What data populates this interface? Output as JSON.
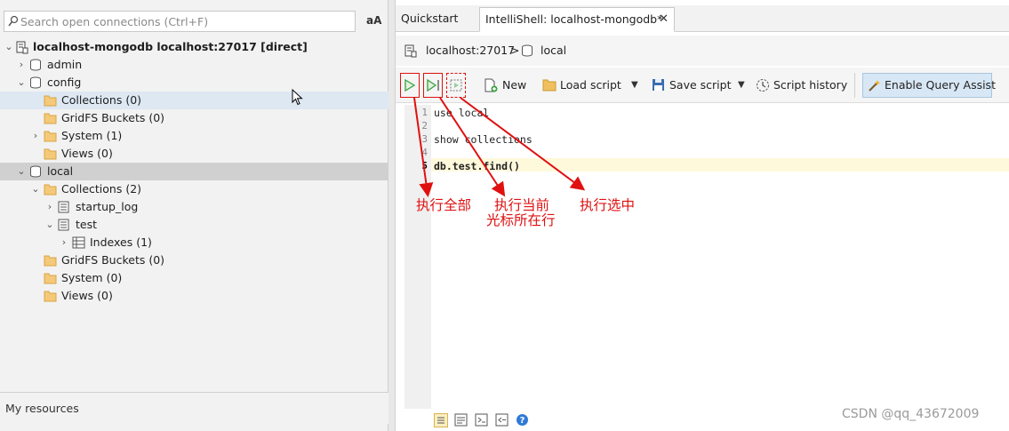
{
  "search": {
    "placeholder": "Search open connections (Ctrl+F)",
    "case_toggle": "aA"
  },
  "tree": {
    "connection": "localhost-mongodb localhost:27017 [direct]",
    "admin": "admin",
    "config": "config",
    "config_collections": "Collections (0)",
    "config_gridfs": "GridFS Buckets (0)",
    "config_system": "System (1)",
    "config_views": "Views (0)",
    "local": "local",
    "local_collections": "Collections (2)",
    "startup_log": "startup_log",
    "test": "test",
    "indexes": "Indexes (1)",
    "local_gridfs": "GridFS Buckets (0)",
    "local_system": "System (0)",
    "local_views": "Views (0)"
  },
  "left_footer": "My resources",
  "tabs": {
    "quickstart": "Quickstart",
    "intellishell": "IntelliShell: localhost-mongodb*",
    "close": "✕"
  },
  "breadcrumb": {
    "host": "localhost:27017",
    "sep": ">",
    "db": "local"
  },
  "toolbar": {
    "new": "New",
    "load_script": "Load script",
    "save_script": "Save script",
    "script_history": "Script history",
    "enable_query_assist": "Enable Query Assist"
  },
  "editor": {
    "line_numbers": [
      "1",
      "2",
      "3",
      "4",
      "5"
    ],
    "lines": [
      "use local",
      "",
      "show collections",
      "",
      "db.test.find()"
    ],
    "current_line": 5
  },
  "annotations": {
    "run_all": "执行全部",
    "run_current_1": "执行当前",
    "run_current_2": "光标所在行",
    "run_selected": "执行选中"
  },
  "watermark": "CSDN @qq_43672009",
  "colors": {
    "annotation_red": "#e01010",
    "selected_row": "#dde8f3",
    "run_green": "#3aa040",
    "query_assist_bg": "#d8e7f5"
  }
}
